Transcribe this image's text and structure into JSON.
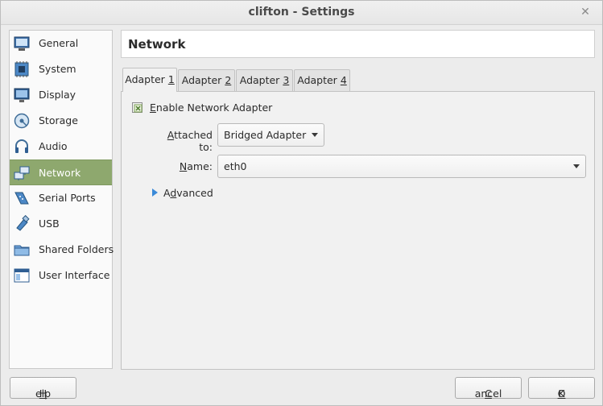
{
  "window": {
    "title": "clifton - Settings"
  },
  "sidebar": {
    "items": [
      {
        "label": "General",
        "icon": "general-icon"
      },
      {
        "label": "System",
        "icon": "system-chip-icon"
      },
      {
        "label": "Display",
        "icon": "display-monitor-icon"
      },
      {
        "label": "Storage",
        "icon": "storage-disk-icon"
      },
      {
        "label": "Audio",
        "icon": "audio-headphones-icon"
      },
      {
        "label": "Network",
        "icon": "network-icon"
      },
      {
        "label": "Serial Ports",
        "icon": "serial-port-icon"
      },
      {
        "label": "USB",
        "icon": "usb-icon"
      },
      {
        "label": "Shared Folders",
        "icon": "shared-folder-icon"
      },
      {
        "label": "User Interface",
        "icon": "user-interface-icon"
      }
    ],
    "active": "Network",
    "active_color": "#8ea86e"
  },
  "page": {
    "title": "Network"
  },
  "tabs": [
    {
      "label_prefix": "Adapter ",
      "label_hotkey": "1"
    },
    {
      "label_prefix": "Adapter ",
      "label_hotkey": "2"
    },
    {
      "label_prefix": "Adapter ",
      "label_hotkey": "3"
    },
    {
      "label_prefix": "Adapter ",
      "label_hotkey": "4"
    }
  ],
  "adapter": {
    "enable_hotkey": "E",
    "enable_rest": "nable Network Adapter",
    "enabled": true,
    "attached_hotkey": "A",
    "attached_rest": "ttached to:",
    "attached_value": "Bridged Adapter",
    "name_hotkey": "N",
    "name_rest": "ame:",
    "name_value": "eth0",
    "advanced_hotkey": "d",
    "advanced_prefix": "A",
    "advanced_rest": "vanced"
  },
  "buttons": {
    "help_hotkey": "H",
    "help_rest": "elp",
    "cancel_hotkey": "C",
    "cancel_rest": "ancel",
    "ok_hotkey": "O",
    "ok_rest": "K"
  }
}
